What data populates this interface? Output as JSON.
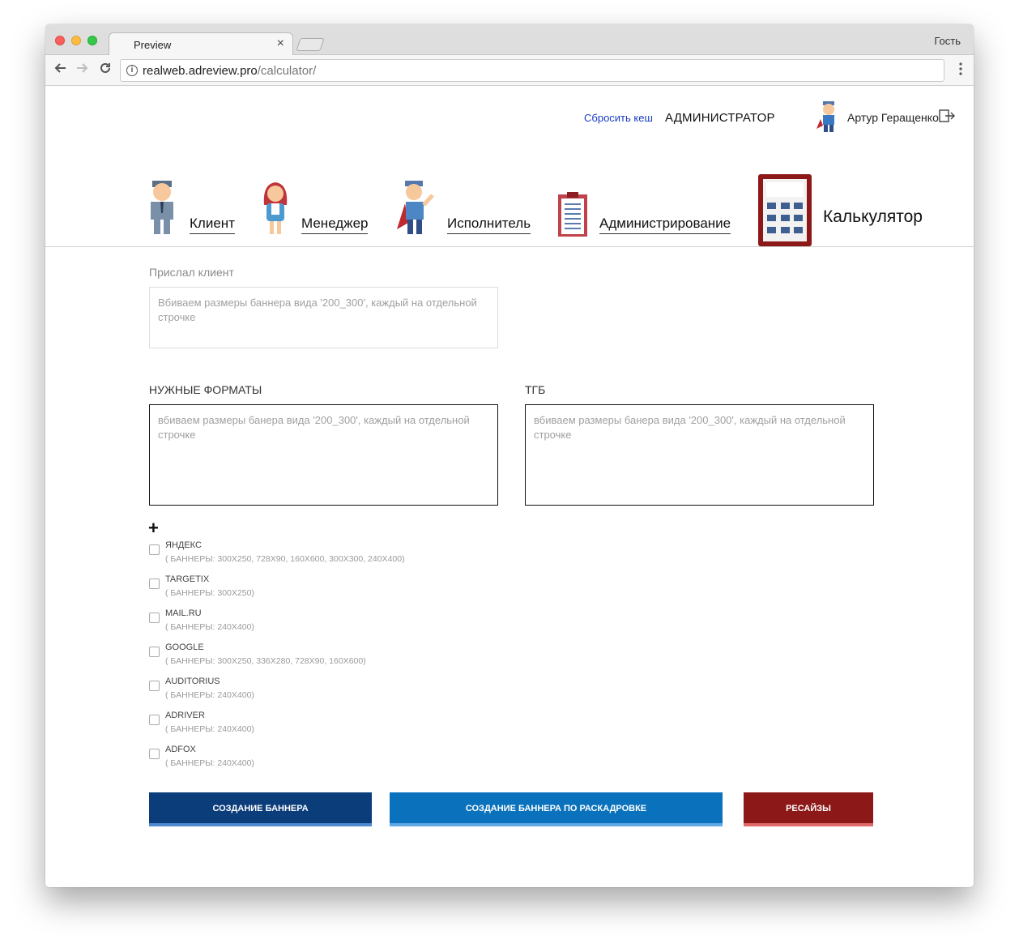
{
  "browser": {
    "tab_title": "Preview",
    "tab_close": "×",
    "profile": "Гость",
    "url_host": "realweb.adreview.pro",
    "url_path": "/calculator/"
  },
  "header": {
    "reset_cache": "Сбросить кеш",
    "admin": "АДМИНИСТРАТОР",
    "user_name": "Артур Геращенко"
  },
  "roles": [
    {
      "label": "Клиент"
    },
    {
      "label": "Менеджер"
    },
    {
      "label": "Исполнитель"
    },
    {
      "label": "Администрирование"
    },
    {
      "label": "Калькулятор"
    }
  ],
  "form": {
    "client_label": "Прислал клиент",
    "client_placeholder": "Вбиваем размеры баннера вида '200_300', каждый на отдельной строчке",
    "formats_label": "НУЖНЫЕ ФОРМАТЫ",
    "formats_placeholder": "вбиваем размеры банера вида '200_300', каждый на отдельной строчке",
    "tgb_label": "ТГБ",
    "tgb_placeholder": "вбиваем размеры банера вида '200_300', каждый на отдельной строчке",
    "plus": "+"
  },
  "platforms": [
    {
      "name": "Яндекс",
      "desc": "( БАННЕРЫ: 300X250, 728X90, 160X600, 300X300, 240X400)"
    },
    {
      "name": "TARGETIX",
      "desc": "( БАННЕРЫ: 300X250)"
    },
    {
      "name": "MAIL.RU",
      "desc": "( БАННЕРЫ: 240X400)"
    },
    {
      "name": "GOOGLE",
      "desc": "( БАННЕРЫ: 300X250, 336X280, 728X90, 160X600)"
    },
    {
      "name": "AUDITORIUS",
      "desc": "( БАННЕРЫ: 240X400)"
    },
    {
      "name": "ADRIVER",
      "desc": "( БАННЕРЫ: 240X400)"
    },
    {
      "name": "ADFOX",
      "desc": "( БАННЕРЫ: 240X400)"
    }
  ],
  "buttons": {
    "create": "СОЗДАНИЕ БАННЕРА",
    "storyboard": "СОЗДАНИЕ БАННЕРА ПО РАСКАДРОВКЕ",
    "resize": "РЕСАЙЗЫ"
  },
  "colors": {
    "button_dark": "#0b3d7a",
    "button_mid": "#0a72bc",
    "button_red": "#8c1818",
    "calc_accent": "#8c1818"
  }
}
